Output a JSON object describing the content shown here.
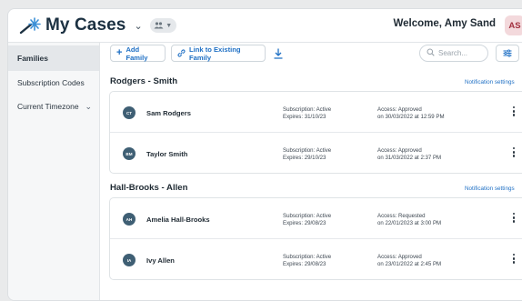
{
  "header": {
    "title": "My Cases",
    "welcome": "Welcome, Amy Sand",
    "user_initials": "AS",
    "logo_icon": "sparkle-wand-icon",
    "group_icon": "people-icon"
  },
  "sidebar": {
    "items": [
      {
        "label": "Families",
        "active": true
      },
      {
        "label": "Subscription Codes"
      },
      {
        "label": "Current Timezone",
        "has_chevron": true
      }
    ]
  },
  "toolbar": {
    "add_family": "Add Family",
    "link_existing": "Link to Existing Family",
    "search_placeholder": "Search...",
    "icons": [
      "plus-icon",
      "link-icon",
      "download-icon",
      "search-icon",
      "filter-icon"
    ]
  },
  "families": [
    {
      "name": "Rodgers - Smith",
      "notification_label": "Notification settings",
      "members": [
        {
          "initials": "CT",
          "name": "Sam Rodgers",
          "subscription": "Subscription: Active",
          "expires": "Expires: 31/10/23",
          "access": "Access: Approved",
          "access_date": "on 30/03/2022 at 12:59 PM"
        },
        {
          "initials": "BM",
          "name": "Taylor Smith",
          "subscription": "Subscription: Active",
          "expires": "Expires: 29/10/23",
          "access": "Access: Approved",
          "access_date": "on 31/03/2022 at 2:37 PM"
        }
      ]
    },
    {
      "name": "Hall-Brooks - Allen",
      "notification_label": "Notification settings",
      "members": [
        {
          "initials": "AH",
          "name": "Amelia Hall-Brooks",
          "subscription": "Subscription: Active",
          "expires": "Expires: 29/08/23",
          "access": "Access: Requested",
          "access_date": "on 22/01/2023 at 3:00 PM"
        },
        {
          "initials": "IA",
          "name": "Ivy Allen",
          "subscription": "Subscription: Active",
          "expires": "Expires: 29/08/23",
          "access": "Access: Approved",
          "access_date": "on 23/01/2022 at 2:45 PM"
        }
      ]
    }
  ],
  "colors": {
    "accent": "#1e6fc4",
    "brand_text": "#1c3142",
    "avatar_bg": "#3f5f74",
    "user_badge_bg": "#f3d9dc",
    "user_badge_text": "#a2303f"
  }
}
